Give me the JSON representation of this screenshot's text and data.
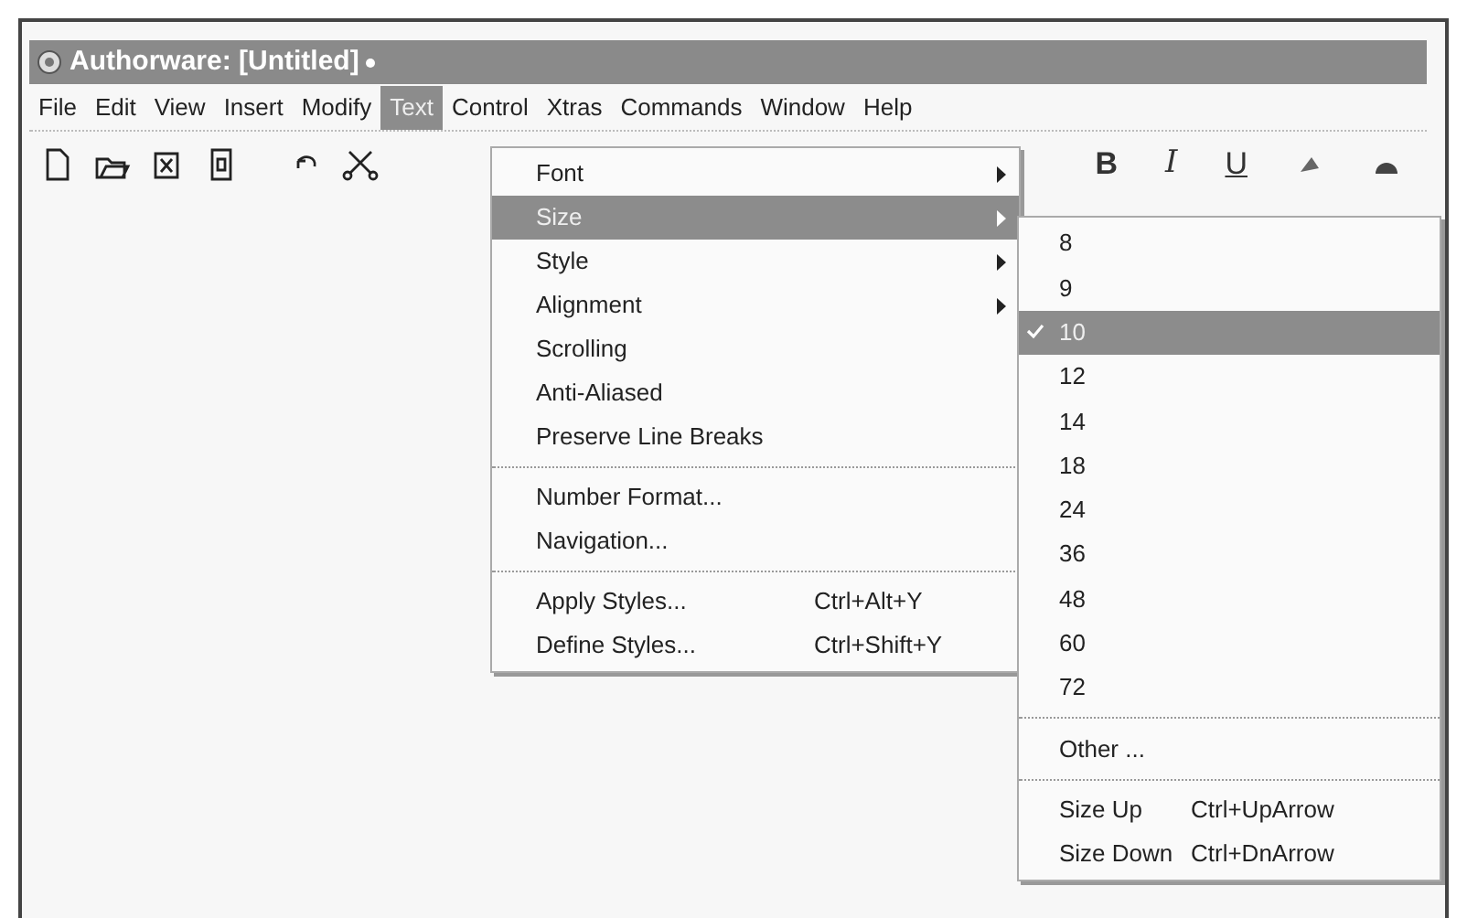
{
  "window": {
    "title": "Authorware: [Untitled]"
  },
  "menu_bar": [
    {
      "label": "File",
      "selected": false
    },
    {
      "label": "Edit",
      "selected": false
    },
    {
      "label": "View",
      "selected": false
    },
    {
      "label": "Insert",
      "selected": false
    },
    {
      "label": "Modify",
      "selected": false
    },
    {
      "label": "Text",
      "selected": true
    },
    {
      "label": "Control",
      "selected": false
    },
    {
      "label": "Xtras",
      "selected": false
    },
    {
      "label": "Commands",
      "selected": false
    },
    {
      "label": "Window",
      "selected": false
    },
    {
      "label": "Help",
      "selected": false
    }
  ],
  "format_buttons": [
    {
      "label": "B",
      "kind": "bold"
    },
    {
      "label": "I",
      "kind": "italic"
    },
    {
      "label": "U",
      "kind": "underline"
    }
  ],
  "text_menu": {
    "sections": [
      [
        {
          "label": "Font",
          "submenu": true,
          "selected": false
        },
        {
          "label": "Size",
          "submenu": true,
          "selected": true
        },
        {
          "label": "Style",
          "submenu": true,
          "selected": false
        },
        {
          "label": "Alignment",
          "submenu": true,
          "selected": false
        },
        {
          "label": "Scrolling",
          "submenu": false,
          "selected": false
        },
        {
          "label": "Anti-Aliased",
          "submenu": false,
          "selected": false
        },
        {
          "label": "Preserve Line Breaks",
          "submenu": false,
          "selected": false
        }
      ],
      [
        {
          "label": "Number Format...",
          "submenu": false,
          "selected": false
        },
        {
          "label": "Navigation...",
          "submenu": false,
          "selected": false
        }
      ],
      [
        {
          "label": "Apply Styles...",
          "shortcut": "Ctrl+Alt+Y",
          "submenu": false,
          "selected": false
        },
        {
          "label": "Define Styles...",
          "shortcut": "Ctrl+Shift+Y",
          "submenu": false,
          "selected": false
        }
      ]
    ]
  },
  "size_menu": {
    "sections": [
      [
        {
          "label": "8",
          "checked": false,
          "selected": false
        },
        {
          "label": "9",
          "checked": false,
          "selected": false
        },
        {
          "label": "10",
          "checked": true,
          "selected": true
        },
        {
          "label": "12",
          "checked": false,
          "selected": false
        },
        {
          "label": "14",
          "checked": false,
          "selected": false
        },
        {
          "label": "18",
          "checked": false,
          "selected": false
        },
        {
          "label": "24",
          "checked": false,
          "selected": false
        },
        {
          "label": "36",
          "checked": false,
          "selected": false
        },
        {
          "label": "48",
          "checked": false,
          "selected": false
        },
        {
          "label": "60",
          "checked": false,
          "selected": false
        },
        {
          "label": "72",
          "checked": false,
          "selected": false
        }
      ],
      [
        {
          "label": "Other ...",
          "checked": false,
          "selected": false
        }
      ],
      [
        {
          "label": "Size Up",
          "shortcut": "Ctrl+UpArrow",
          "checked": false,
          "selected": false
        },
        {
          "label": "Size Down",
          "shortcut": "Ctrl+DnArrow",
          "checked": false,
          "selected": false
        }
      ]
    ]
  }
}
